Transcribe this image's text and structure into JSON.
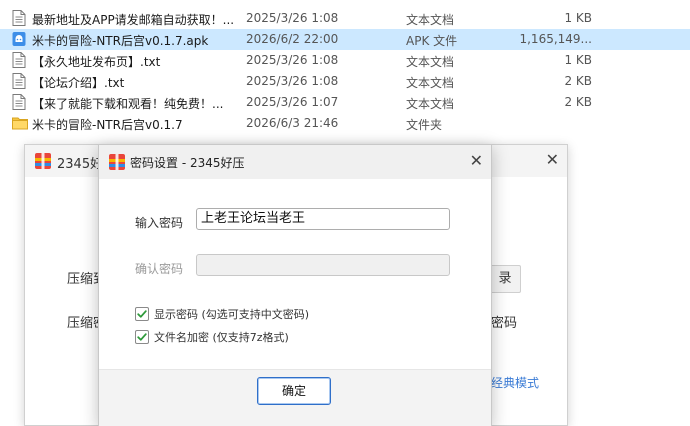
{
  "file_list": {
    "rows": [
      {
        "name": "最新地址及APP请发邮箱自动获取！...",
        "date": "2025/3/26 1:08",
        "type": "文本文档",
        "size": "1 KB",
        "icon": "text-file-icon",
        "selected": false
      },
      {
        "name": "米卡的冒险-NTR后宫v0.1.7.apk",
        "date": "2026/6/2 22:00",
        "type": "APK 文件",
        "size": "1,165,149...",
        "icon": "apk-file-icon",
        "selected": true
      },
      {
        "name": "【永久地址发布页】.txt",
        "date": "2025/3/26 1:08",
        "type": "文本文档",
        "size": "1 KB",
        "icon": "text-file-icon",
        "selected": false
      },
      {
        "name": "【论坛介绍】.txt",
        "date": "2025/3/26 1:08",
        "type": "文本文档",
        "size": "2 KB",
        "icon": "text-file-icon",
        "selected": false
      },
      {
        "name": "【来了就能下载和观看！纯免费！...",
        "date": "2025/3/26 1:07",
        "type": "文本文档",
        "size": "2 KB",
        "icon": "text-file-icon",
        "selected": false
      },
      {
        "name": "米卡的冒险-NTR后宫v0.1.7",
        "date": "2026/6/3 21:46",
        "type": "文件夹",
        "size": "",
        "icon": "folder-icon",
        "selected": false
      }
    ]
  },
  "bg_window": {
    "title": "2345好",
    "label1": "压缩到",
    "label2": "压缩密",
    "button_fragment": "录",
    "text_fragment": "密码",
    "link": "经典模式",
    "close_icon": "close-icon"
  },
  "dialog": {
    "title": "密码设置 - 2345好压",
    "password_label": "输入密码",
    "password_value": "上老王论坛当老王",
    "confirm_label": "确认密码",
    "confirm_value": "",
    "show_password_label": "显示密码 (勾选可支持中文密码)",
    "show_password_checked": true,
    "encrypt_names_label": "文件名加密 (仅支持7z格式)",
    "encrypt_names_checked": true,
    "ok_label": "确定",
    "close_icon": "close-icon"
  },
  "colors": {
    "selection": "#cce8ff",
    "accent": "#2f6fc9",
    "check": "#2e9a3a",
    "link": "#3a7bd5"
  }
}
